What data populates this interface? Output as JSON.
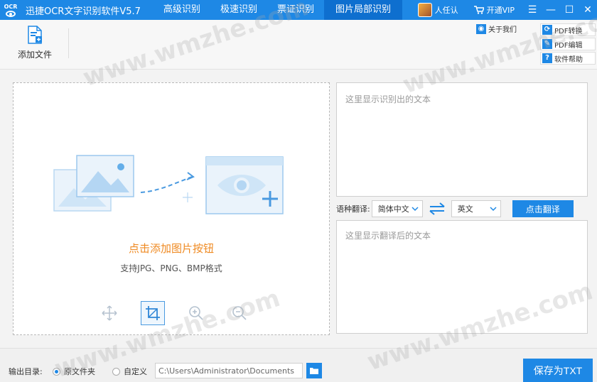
{
  "app": {
    "logo_text": "OCR",
    "title": "迅捷OCR文字识别软件V5.7",
    "tabs": [
      {
        "label": "高级识别"
      },
      {
        "label": "极速识别"
      },
      {
        "label": "票证识别"
      },
      {
        "label": "图片局部识别"
      }
    ],
    "active_tab": 3,
    "user_name": "人任认",
    "vip_label": "开通VIP"
  },
  "window_controls": {
    "menu": "☰",
    "minimize": "—",
    "maximize": "☐",
    "close": "✕"
  },
  "toolbar": {
    "add_file_label": "添加文件",
    "about_label": "关于我们",
    "side_buttons": [
      {
        "label": "PDF转换"
      },
      {
        "label": "PDF编辑"
      },
      {
        "label": "软件帮助"
      }
    ]
  },
  "dropzone": {
    "title": "点击添加图片按钮",
    "subtitle": "支持JPG、PNG、BMP格式"
  },
  "result": {
    "placeholder": "这里显示识别出的文本"
  },
  "translate": {
    "label": "语种翻译:",
    "source_lang": "简体中文",
    "target_lang": "英文",
    "button_label": "点击翻译",
    "placeholder": "这里显示翻译后的文本"
  },
  "output": {
    "label": "输出目录:",
    "option_original": "原文件夹",
    "option_custom": "自定义",
    "selected": "原文件夹",
    "path": "C:\\Users\\Administrator\\Documents"
  },
  "save_button": "保存为TXT",
  "watermark": "www.wmzhe.com",
  "colors": {
    "accent": "#1e88e5",
    "highlight": "#ef8a22"
  }
}
